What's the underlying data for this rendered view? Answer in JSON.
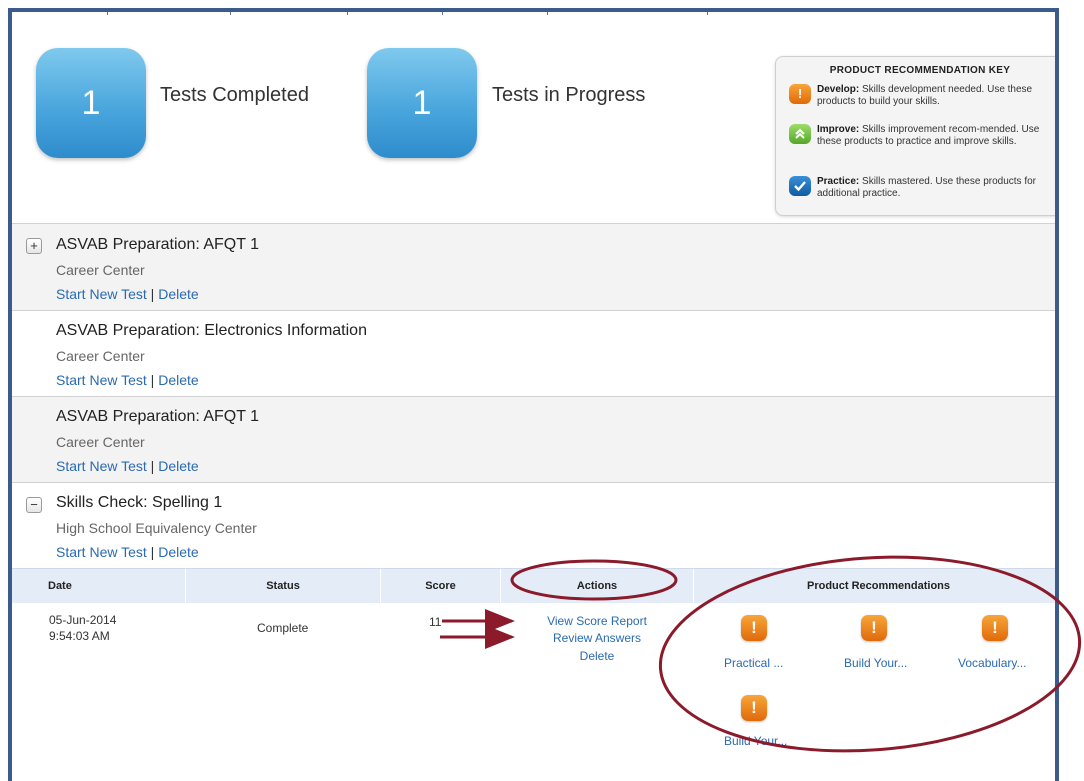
{
  "summary": {
    "completed_count": "1",
    "completed_label": "Tests Completed",
    "in_progress_count": "1",
    "in_progress_label": "Tests in Progress"
  },
  "key": {
    "title": "PRODUCT RECOMMENDATION KEY",
    "items": [
      {
        "icon": "exclamation-icon",
        "name": "Develop:",
        "text": "Skills development needed. Use these products to build your skills.",
        "color": "#e8791a"
      },
      {
        "icon": "double-chevron-up-icon",
        "name": "Improve:",
        "text": "Skills improvement recom-mended. Use these products to practice and improve skills.",
        "color": "#6cbf3c"
      },
      {
        "icon": "checkmark-icon",
        "name": "Practice:",
        "text": "Skills mastered. Use these products for additional practice.",
        "color": "#1a6fbe"
      }
    ]
  },
  "tests": [
    {
      "title": "ASVAB Preparation: AFQT 1",
      "center": "Career Center",
      "start": "Start New Test",
      "sep": "|",
      "delete": "Delete",
      "toggle": "+"
    },
    {
      "title": "ASVAB Preparation: Electronics Information",
      "center": "Career Center",
      "start": "Start New Test",
      "sep": "|",
      "delete": "Delete"
    },
    {
      "title": "ASVAB Preparation: AFQT 1",
      "center": "Career Center",
      "start": "Start New Test",
      "sep": "|",
      "delete": "Delete"
    },
    {
      "title": "Skills Check: Spelling 1",
      "center": "High School Equivalency Center",
      "start": "Start New Test",
      "sep": "|",
      "delete": "Delete",
      "toggle": "−"
    }
  ],
  "results": {
    "headers": [
      "Date",
      "Status",
      "Score",
      "Actions",
      "Product Recommendations"
    ],
    "row": {
      "date": "05-Jun-2014",
      "time": "9:54:03 AM",
      "status": "Complete",
      "score": "11",
      "actions": [
        "View Score Report",
        "Review Answers",
        "Delete"
      ],
      "recommendations": [
        "Practical ...",
        "Build Your...",
        "Vocabulary...",
        "Build Your..."
      ]
    }
  },
  "annotation_color": "#8b1a2b",
  "accent_link": "#2a6ab0"
}
